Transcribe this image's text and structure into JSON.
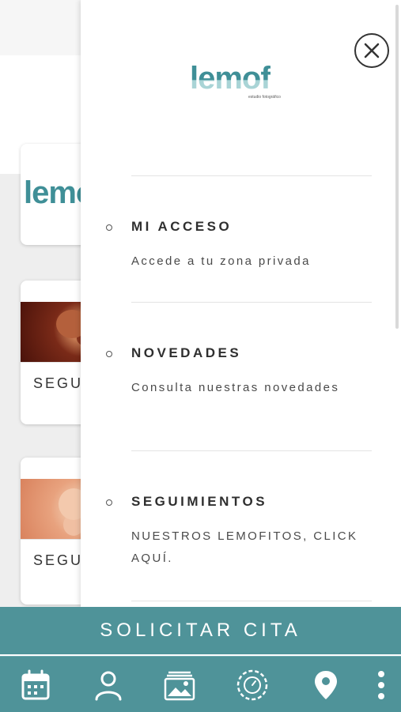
{
  "background": {
    "caption_1": "SEGU",
    "caption_2": "SEGU",
    "logo_text": "lemo"
  },
  "drawer": {
    "brand": {
      "word": "lemof",
      "tagline": "estudio fotográfico"
    },
    "items": [
      {
        "title": "MI ACCESO",
        "description": "Accede a tu zona privada"
      },
      {
        "title": "NOVEDADES",
        "description": "Consulta nuestras novedades"
      },
      {
        "title": "SEGUIMIENTOS",
        "description": "NUESTROS LEMOFITOS, CLICK AQUÍ."
      }
    ]
  },
  "cta": {
    "label": "SOLICITAR CITA"
  },
  "tabbar": {
    "icons": [
      "calendar-icon",
      "user-icon",
      "gallery-icon",
      "timer-icon",
      "location-pin-icon",
      "more-vertical-icon"
    ]
  },
  "colors": {
    "accent": "#4f9399",
    "brand": "#3f8f97"
  }
}
